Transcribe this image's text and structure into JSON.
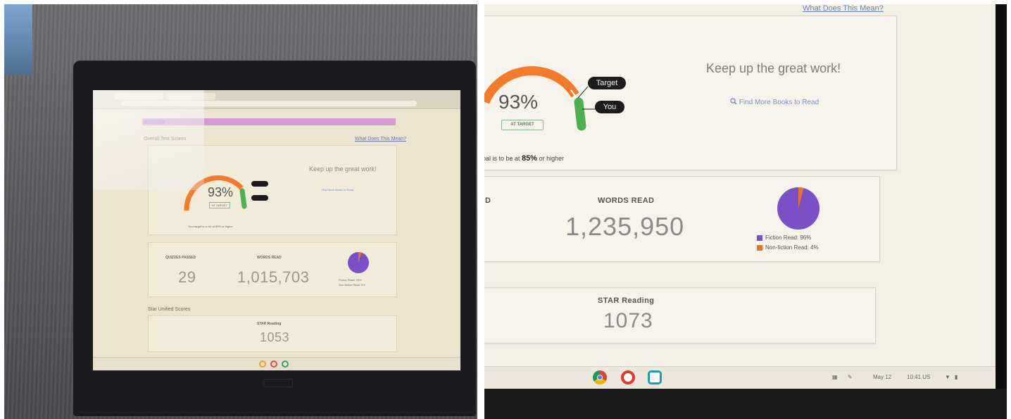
{
  "left_photo": {
    "header": {
      "section_title": "Overall Test Scores",
      "what_link": "What Does This Mean?"
    },
    "gauge": {
      "percent": "93%",
      "status": "AT TARGET",
      "target_label": "Target",
      "you_label": "You",
      "goal_text": "Your target is to be at 85% or higher"
    },
    "message": {
      "text": "Keep up the great work!",
      "link": "Find More Books to Read"
    },
    "stats": [
      {
        "label": "QUIZZES PASSED",
        "value": "29"
      },
      {
        "label": "WORDS READ",
        "value": "1,015,703"
      }
    ],
    "pie_legend": [
      {
        "label": "Fiction Read: 95%"
      },
      {
        "label": "Non-fiction Read: 5%"
      }
    ],
    "section2_title": "Star Unified Scores",
    "star": {
      "label": "STAR Reading",
      "value": "1053"
    }
  },
  "right_photo": {
    "what_link": "What Does This Mean?",
    "keep_text": "Keep up the great work!",
    "find_link": "Find More Books to Read",
    "gauge": {
      "percent": "93%",
      "status": "AT TARGET",
      "target_label": "Target",
      "you_label": "You",
      "goal_prefix": "oal is to be at ",
      "goal_value": "85%",
      "goal_suffix": " or higher"
    },
    "words": {
      "edge_letter": "D",
      "label": "WORDS READ",
      "value": "1,235,950"
    },
    "pie": {
      "fiction_percent": 96,
      "nonfiction_percent": 4,
      "legend": [
        {
          "label": "Fiction Read: 96%"
        },
        {
          "label": "Non-fiction Read: 4%"
        }
      ]
    },
    "star": {
      "label": "STAR Reading",
      "value": "1073"
    },
    "taskbar": {
      "date": "May 12",
      "time": "10:41 US"
    }
  },
  "colors": {
    "gauge_orange": "#f47b2b",
    "gauge_green": "#4caf50",
    "fiction_purple": "#7b4fc8",
    "nonfiction_orange": "#e8742b",
    "banner_pink": "#d69ad3"
  },
  "icons": [
    "search-icon",
    "chrome-icon",
    "docs-icon",
    "meet-icon",
    "wifi-icon",
    "battery-icon"
  ]
}
